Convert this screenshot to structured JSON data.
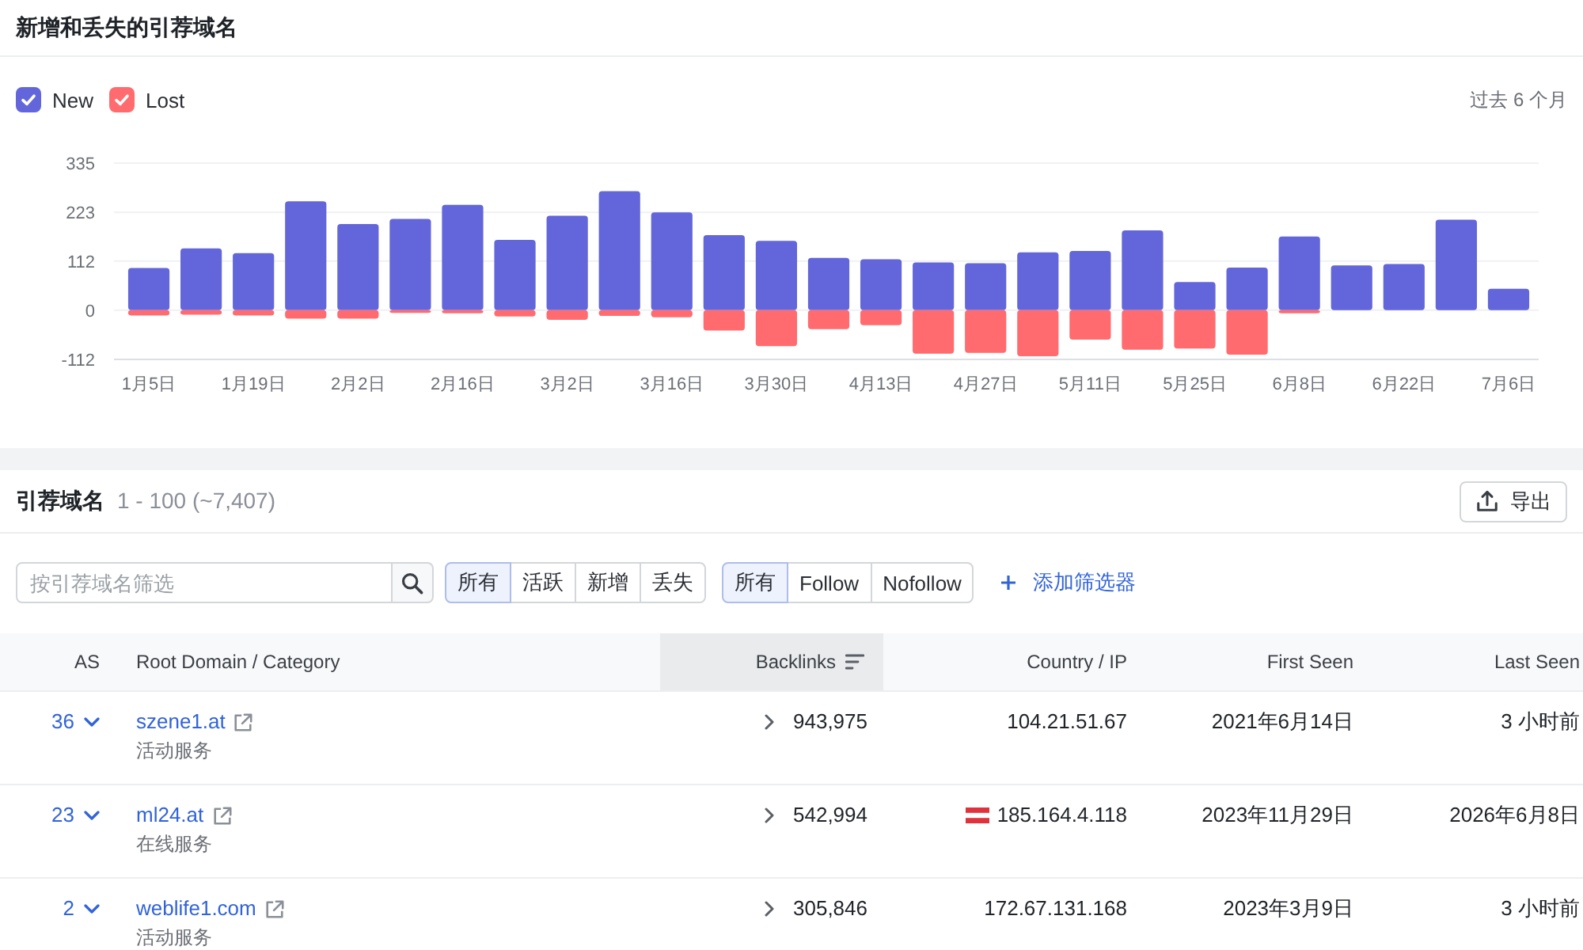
{
  "new_lost_panel": {
    "title": "新增和丢失的引荐域名",
    "legend": [
      {
        "checked": true
      },
      {
        "checked": true
      }
    ],
    "period": "过去 6 个月",
    "chart_data": {
      "type": "bar",
      "stacked": true,
      "grid": true,
      "categories": [
        "1月5日",
        null,
        "1月19日",
        null,
        "2月2日",
        null,
        "2月16日",
        null,
        "3月2日",
        null,
        "3月16日",
        null,
        "3月30日",
        null,
        "4月13日",
        null,
        "4月27日",
        null,
        "5月11日",
        null,
        "5月25日",
        null,
        "6月8日",
        null,
        "6月22日",
        null,
        "7月6日"
      ],
      "ylim": [
        -112,
        335
      ],
      "yticks": [
        -112,
        0,
        112,
        223,
        335
      ],
      "series": [
        {
          "name": "New",
          "color": "#6366DA",
          "values": [
            96,
            141,
            130,
            248,
            196,
            208,
            240,
            160,
            215,
            271,
            223,
            171,
            158,
            119,
            116,
            109,
            107,
            132,
            135,
            182,
            64,
            97,
            168,
            102,
            105,
            206,
            49
          ]
        },
        {
          "name": "Lost",
          "color": "#FF6B6E",
          "values": [
            -12,
            -10,
            -12,
            -19,
            -19,
            -6,
            -7,
            -14,
            -22,
            -13,
            -16,
            -46,
            -82,
            -43,
            -34,
            -99,
            -97,
            -105,
            -67,
            -90,
            -87,
            -101,
            -7,
            0,
            0,
            0,
            0
          ]
        }
      ]
    }
  },
  "referring_domains": {
    "title": "引荐域名",
    "range": "1 - 100 (~7,407)",
    "export_button": "导出",
    "search": {
      "placeholder": "按引荐域名筛选"
    },
    "status_filters": [
      {
        "label": "所有",
        "selected": true
      },
      {
        "label": "活跃",
        "selected": false
      },
      {
        "label": "新增",
        "selected": false
      },
      {
        "label": "丢失",
        "selected": false
      }
    ],
    "link_filters": [
      {
        "label": "所有",
        "selected": true
      },
      {
        "label": "Follow",
        "selected": false
      },
      {
        "label": "Nofollow",
        "selected": false
      }
    ],
    "add_filter": "添加筛选器",
    "table": {
      "columns": [
        {
          "label": "AS",
          "sorted": false
        },
        {
          "label": "Root Domain / Category",
          "sorted": false
        },
        {
          "label": "Backlinks",
          "sorted": true
        },
        {
          "label": "Country / IP",
          "sorted": false
        },
        {
          "label": "First Seen",
          "sorted": false
        },
        {
          "label": "Last Seen",
          "sorted": false
        }
      ],
      "rows": [
        {
          "as": "36",
          "domain": "szene1.at",
          "category": "活动服务",
          "backlinks": "943,975",
          "flag": false,
          "ip": "104.21.51.67",
          "first_seen": "2021年6月14日",
          "last_seen": "3 小时前"
        },
        {
          "as": "23",
          "domain": "ml24.at",
          "category": "在线服务",
          "backlinks": "542,994",
          "flag": true,
          "ip": "185.164.4.118",
          "first_seen": "2023年11月29日",
          "last_seen": "2026年6月8日"
        },
        {
          "as": "2",
          "domain": "weblife1.com",
          "category": "活动服务",
          "backlinks": "305,846",
          "flag": false,
          "ip": "172.67.131.168",
          "first_seen": "2023年3月9日",
          "last_seen": "3 小时前"
        }
      ]
    }
  }
}
